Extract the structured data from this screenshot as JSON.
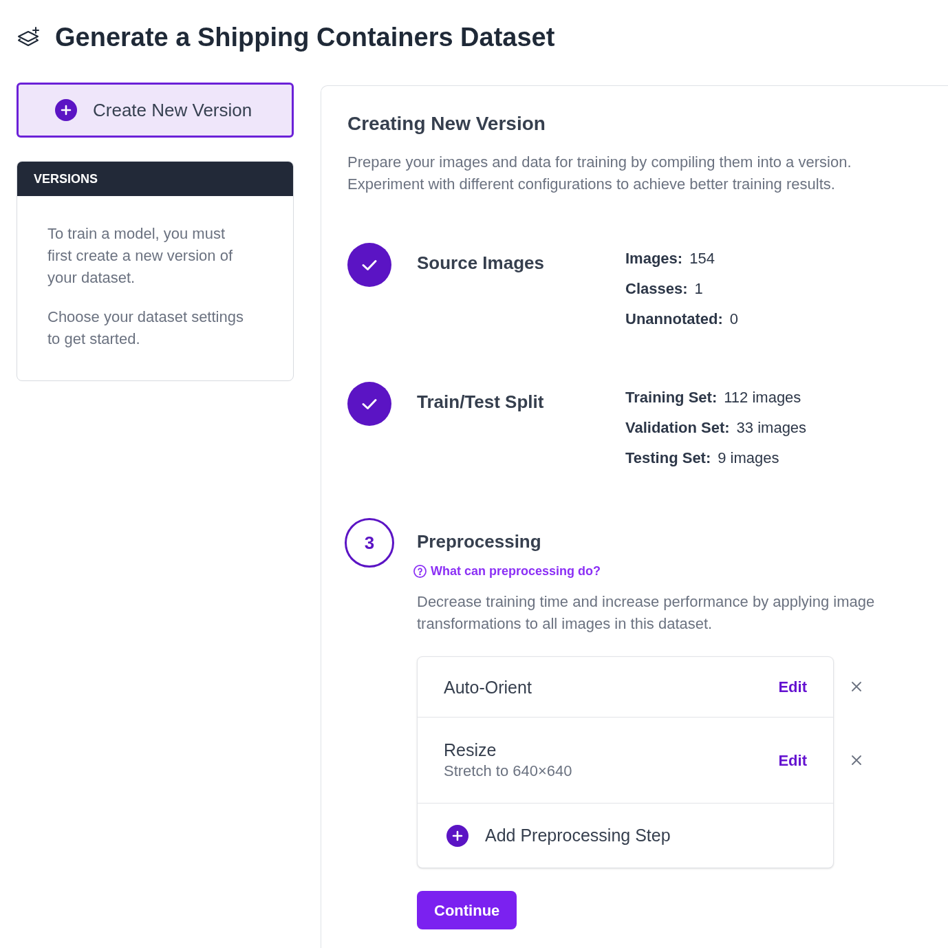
{
  "page": {
    "title": "Generate a Shipping Containers Dataset"
  },
  "sidebar": {
    "create_button": "Create New Version",
    "versions": {
      "heading": "VERSIONS",
      "paragraphs": [
        "To train a model, you must first create a new version of your dataset.",
        "Choose your dataset settings to get started."
      ]
    }
  },
  "main": {
    "heading": "Creating New Version",
    "description": "Prepare your images and data for training by compiling them into a version. Experiment with different configurations to achieve better training results.",
    "steps": [
      {
        "title": "Source Images",
        "completed": true,
        "stats": [
          {
            "label": "Images:",
            "value": "154"
          },
          {
            "label": "Classes:",
            "value": "1"
          },
          {
            "label": "Unannotated:",
            "value": "0"
          }
        ]
      },
      {
        "title": "Train/Test Split",
        "completed": true,
        "stats": [
          {
            "label": "Training Set:",
            "value": "112 images"
          },
          {
            "label": "Validation Set:",
            "value": "33 images"
          },
          {
            "label": "Testing Set:",
            "value": "9 images"
          }
        ]
      },
      {
        "title": "Preprocessing",
        "completed": false,
        "number": "3",
        "help_link": "What can preprocessing do?",
        "description": "Decrease training time and increase performance by applying image transformations to all images in this dataset.",
        "transforms": [
          {
            "name": "Auto-Orient",
            "action": "Edit"
          },
          {
            "name": "Resize",
            "detail": "Stretch to 640×640",
            "action": "Edit"
          }
        ],
        "add_step": "Add Preprocessing Step",
        "continue_button": "Continue"
      }
    ]
  }
}
